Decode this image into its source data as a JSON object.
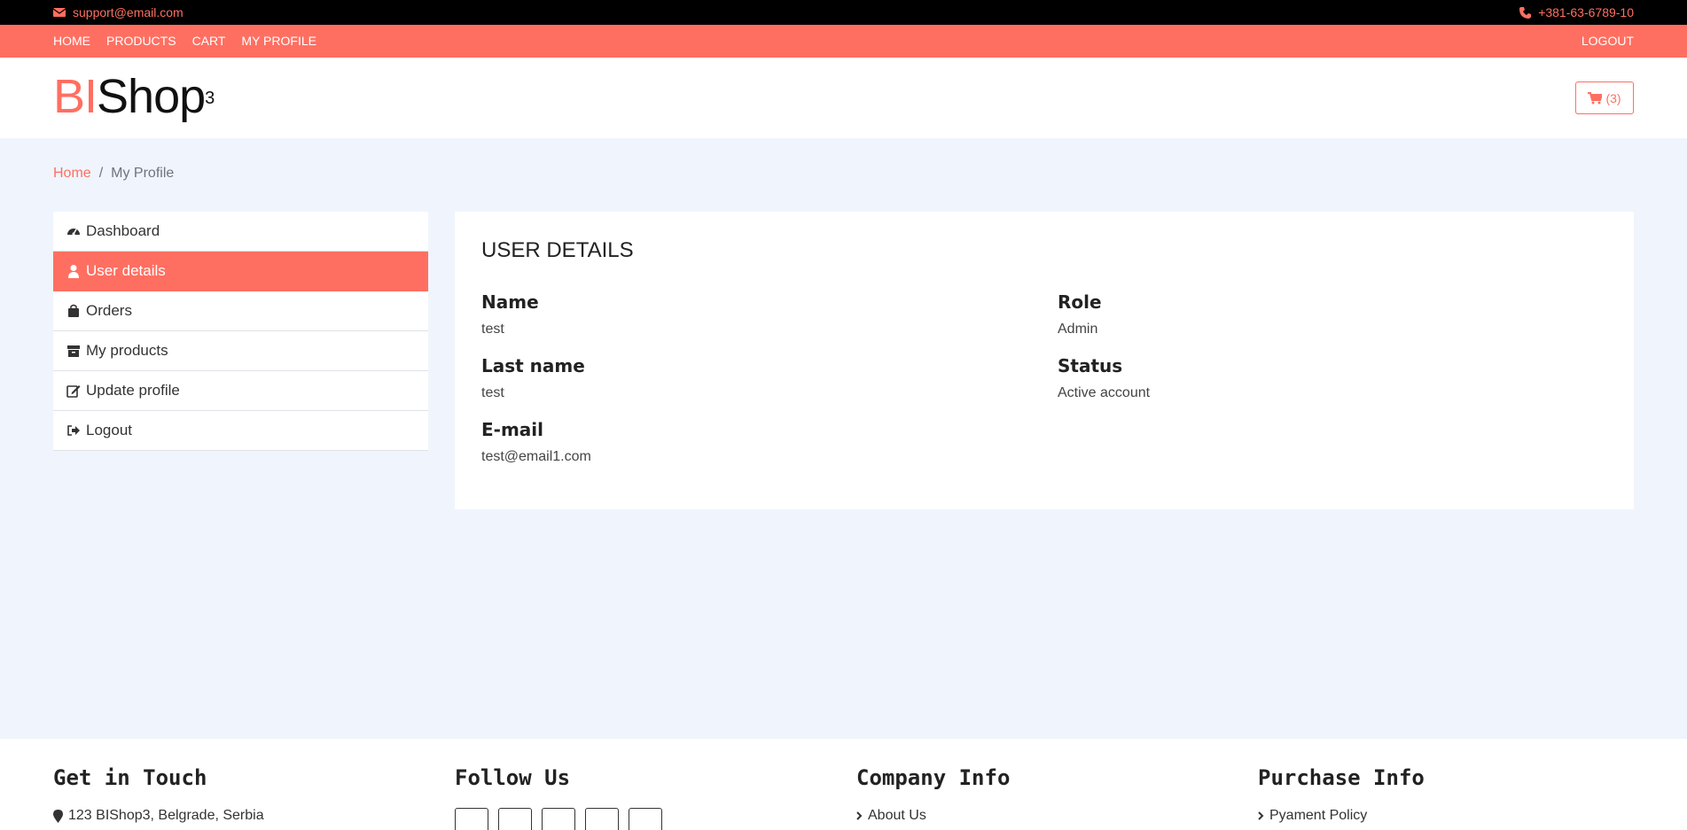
{
  "topbar": {
    "email": "support@email.com",
    "phone": "+381-63-6789-10"
  },
  "nav": {
    "home": "HOME",
    "products": "PRODUCTS",
    "cart": "CART",
    "profile": "MY PROFILE",
    "logout": "LOGOUT"
  },
  "logo": {
    "part1": "BI",
    "part2": "Shop",
    "sup": "3"
  },
  "cart": {
    "count": "(3)"
  },
  "breadcrumb": {
    "home": "Home",
    "sep": "/",
    "current": "My Profile"
  },
  "menu": {
    "items": [
      {
        "label": "Dashboard",
        "icon": "dashboard-icon"
      },
      {
        "label": "User details",
        "icon": "user-icon"
      },
      {
        "label": "Orders",
        "icon": "bag-icon"
      },
      {
        "label": "My products",
        "icon": "box-icon"
      },
      {
        "label": "Update profile",
        "icon": "edit-icon"
      },
      {
        "label": "Logout",
        "icon": "logout-icon"
      }
    ],
    "active": "User details"
  },
  "details": {
    "title": "USER DETAILS",
    "name_label": "Name",
    "name_value": "test",
    "lastname_label": "Last name",
    "lastname_value": "test",
    "email_label": "E-mail",
    "email_value": "test@email1.com",
    "role_label": "Role",
    "role_value": "Admin",
    "status_label": "Status",
    "status_value": "Active account"
  },
  "footer": {
    "col1_title": "Get in Touch",
    "address": "123 BIShop3, Belgrade, Serbia",
    "col2_title": "Follow Us",
    "col3_title": "Company Info",
    "about": "About Us",
    "col4_title": "Purchase Info",
    "payment_policy": "Pyament Policy"
  },
  "colors": {
    "accent": "#ff6f61",
    "background": "#f0f4fd",
    "topbar": "#000000"
  }
}
